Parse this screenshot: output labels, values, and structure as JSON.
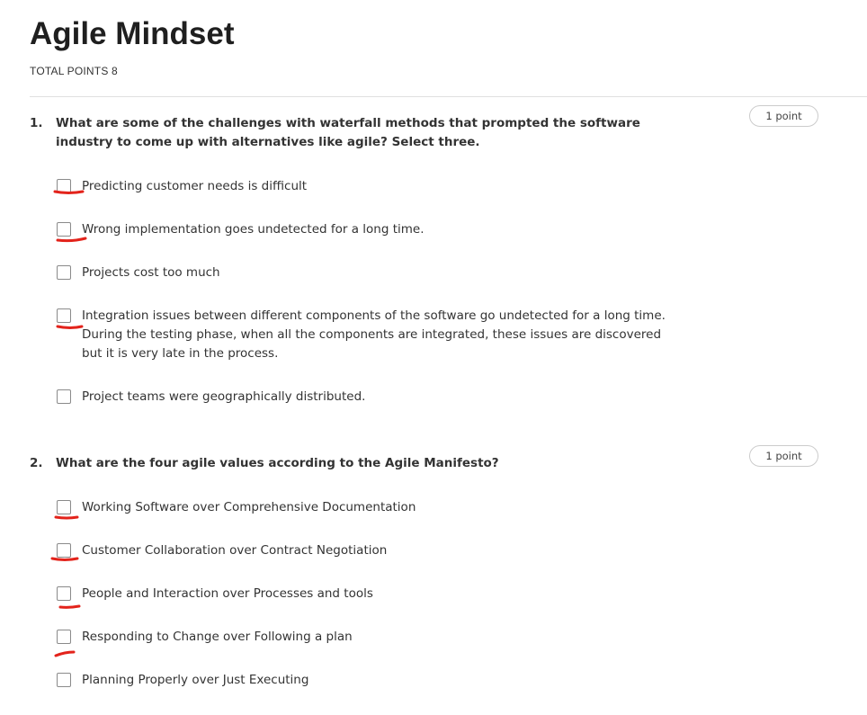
{
  "quiz": {
    "title": "Agile Mindset",
    "total_points": "TOTAL POINTS 8",
    "annotation_color": "#e3231b",
    "questions": [
      {
        "number": "1.",
        "text": "What are some of the challenges with waterfall methods that prompted the software industry to come up with alternatives like agile? Select three.",
        "points": "1 point",
        "options": [
          {
            "label": "Predicting customer needs is difficult",
            "checked": false,
            "hand_marked": true
          },
          {
            "label": "Wrong implementation goes undetected for a long time.",
            "checked": false,
            "hand_marked": true
          },
          {
            "label": "Projects cost too much",
            "checked": false,
            "hand_marked": false
          },
          {
            "label": "Integration issues between different components of the software go undetected for a long time. During the testing phase, when all the components are integrated, these issues are discovered but it is very late in the process.",
            "checked": false,
            "hand_marked": true
          },
          {
            "label": "Project teams were geographically distributed.",
            "checked": false,
            "hand_marked": false
          }
        ]
      },
      {
        "number": "2.",
        "text": "What are the four agile values according to the Agile Manifesto?",
        "points": "1 point",
        "options": [
          {
            "label": "Working Software over Comprehensive Documentation",
            "checked": false,
            "hand_marked": true
          },
          {
            "label": "Customer Collaboration over Contract Negotiation",
            "checked": false,
            "hand_marked": true
          },
          {
            "label": "People and Interaction over Processes and tools",
            "checked": false,
            "hand_marked": true
          },
          {
            "label": "Responding to Change over Following a plan",
            "checked": false,
            "hand_marked": true
          },
          {
            "label": "Planning Properly over Just Executing",
            "checked": false,
            "hand_marked": false
          }
        ]
      }
    ]
  }
}
